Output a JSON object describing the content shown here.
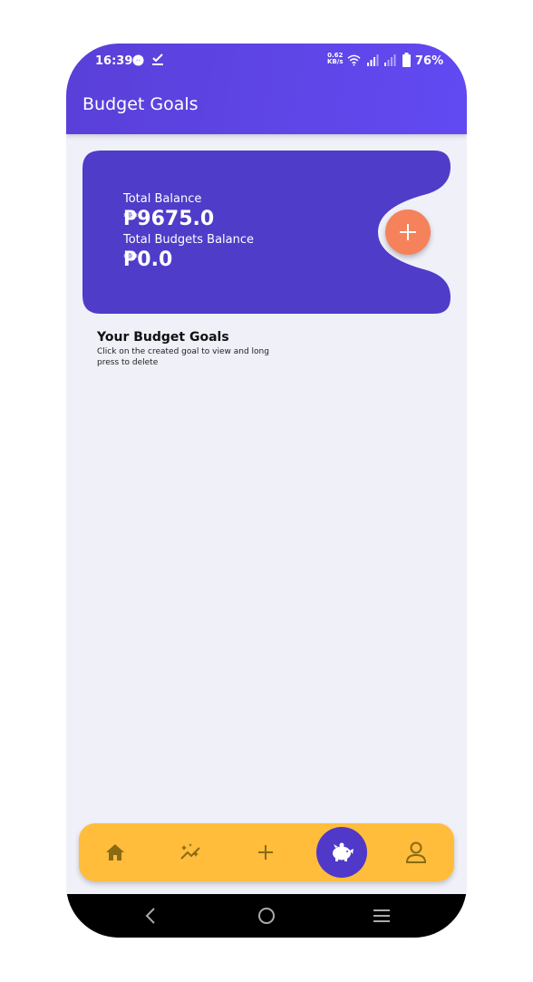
{
  "status_bar": {
    "time": "16:39",
    "network_speed_value": "0.62",
    "network_speed_unit": "KB/s",
    "battery": "76%",
    "icons": [
      "messenger-icon",
      "task-check-icon",
      "wifi-icon",
      "signal-icon",
      "signal-icon",
      "battery-icon"
    ]
  },
  "app_bar": {
    "title": "Budget Goals"
  },
  "balance_card": {
    "total_balance_label": "Total Balance",
    "total_balance_value": "₱9675.0",
    "budgets_balance_label": "Total Budgets Balance",
    "budgets_balance_value": "₱0.0",
    "add_button_icon": "plus-icon"
  },
  "goals_section": {
    "title": "Your Budget Goals",
    "subtitle": "Click on the created goal to view and long press to delete"
  },
  "bottom_nav": {
    "items": [
      {
        "icon": "home-icon",
        "active": false
      },
      {
        "icon": "stats-sparkle-icon",
        "active": false
      },
      {
        "icon": "plus-icon",
        "active": false
      },
      {
        "icon": "piggy-bank-icon",
        "active": true
      },
      {
        "icon": "profile-icon",
        "active": false
      }
    ]
  },
  "colors": {
    "primary": "#5a3fd8",
    "card": "#4f3cc9",
    "fab": "#f5825a",
    "nav_bar": "#ffbd3b",
    "background": "#f0f0f9"
  }
}
